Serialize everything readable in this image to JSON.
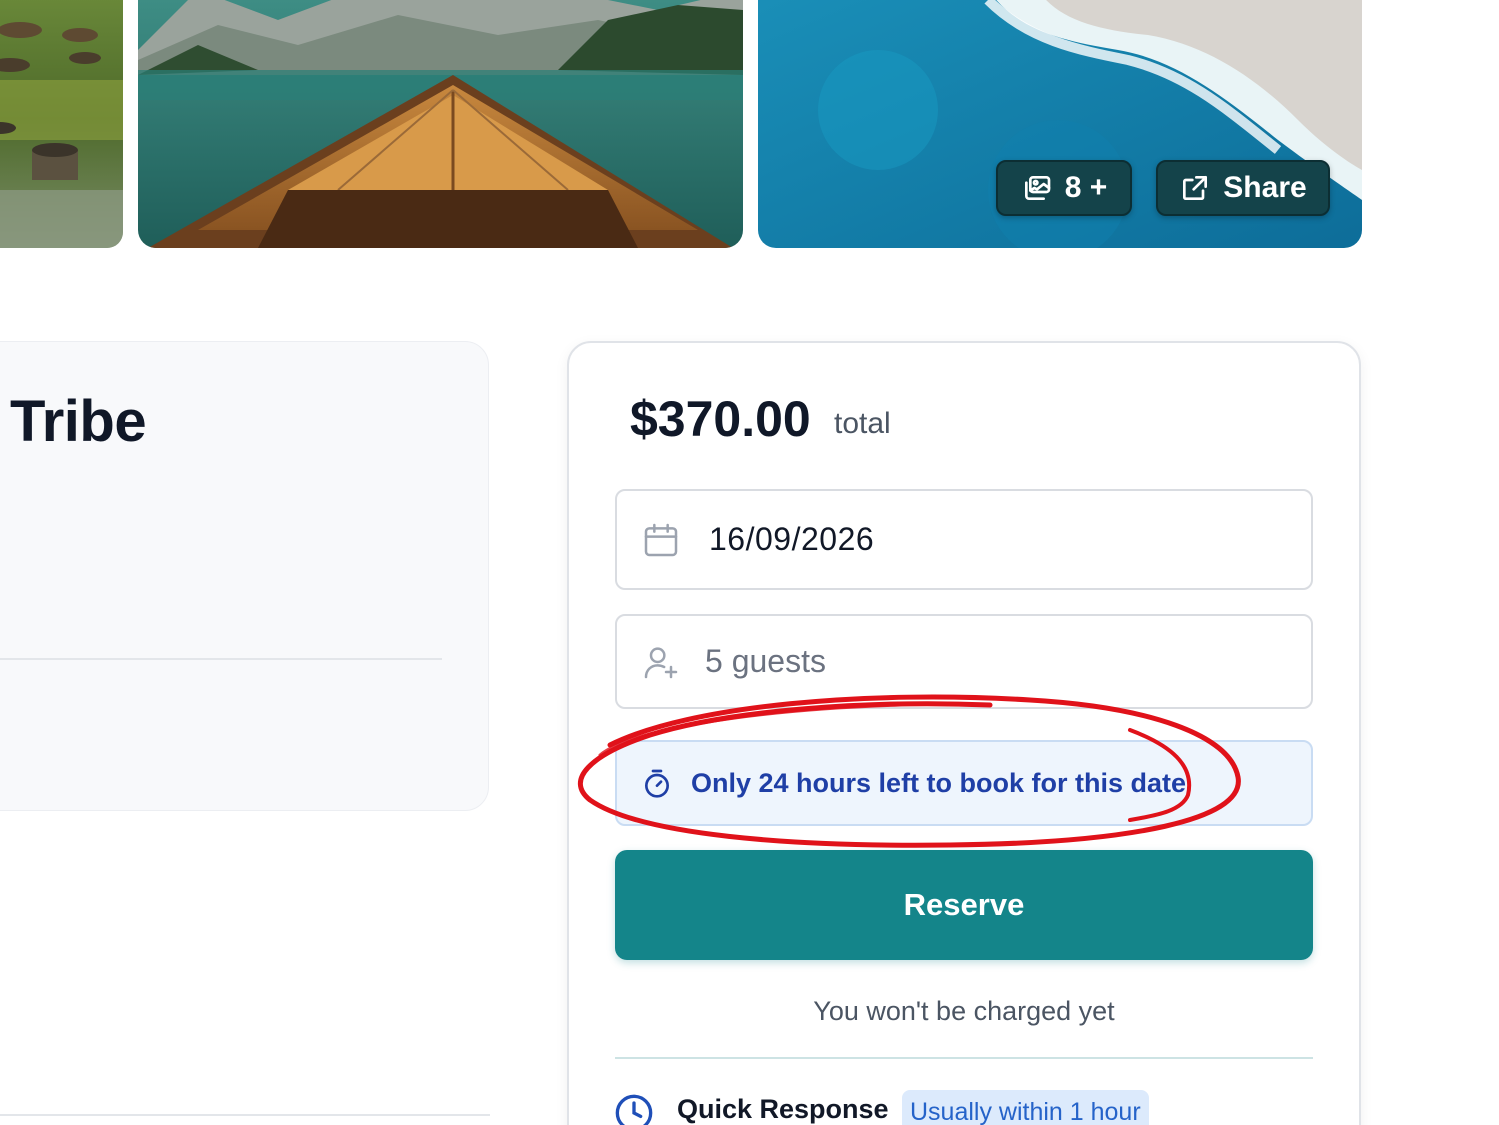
{
  "gallery": {
    "photo_count_label": "8 +",
    "share_label": "Share",
    "icons": {
      "photos": "gallery-icon",
      "share": "external-link-icon"
    }
  },
  "listing": {
    "title": "Tribe"
  },
  "booking": {
    "price": "$370.00",
    "price_suffix": "total",
    "date_value": "16/09/2026",
    "guests_value": "5 guests",
    "urgency_text": "Only 24 hours left to book for this date",
    "reserve_label": "Reserve",
    "charge_note": "You won't be charged yet",
    "quick_response_label": "Quick Response",
    "quick_response_badge": "Usually within 1 hour",
    "icons": {
      "date": "calendar-icon",
      "guests": "add-user-icon",
      "urgency": "stopwatch-icon",
      "quick_response": "clock-icon"
    }
  },
  "colors": {
    "accent": "#14858a",
    "gallery_button": "#14434a",
    "urgency_text": "#1f3fa6",
    "urgency_bg": "#eef5fd",
    "annotation": "#e0121a"
  }
}
